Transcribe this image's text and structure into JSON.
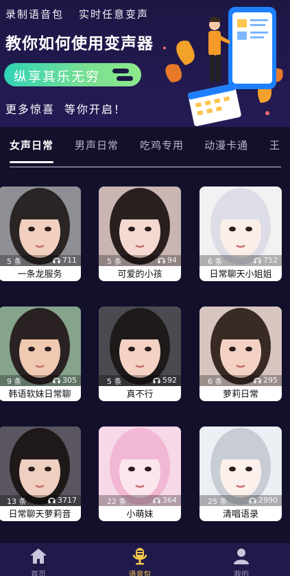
{
  "banner": {
    "top_left": "录制语音包",
    "top_right": "实时任意变声",
    "title": "教你如何使用变声器",
    "pill": "纵享其乐无穷",
    "bottom_left": "更多惊喜",
    "bottom_right": "等你开启！"
  },
  "tabs": [
    {
      "label": "女声日常",
      "active": true
    },
    {
      "label": "男声日常",
      "active": false
    },
    {
      "label": "吃鸡专用",
      "active": false
    },
    {
      "label": "动漫卡通",
      "active": false
    },
    {
      "label": "王",
      "active": false
    }
  ],
  "cards": [
    {
      "count": "5 条",
      "plays": "711",
      "name": "一条龙服务"
    },
    {
      "count": "5 条",
      "plays": "94",
      "name": "可爱的小孩"
    },
    {
      "count": "6 条",
      "plays": "752",
      "name": "日常聊天小姐姐"
    },
    {
      "count": "9 条",
      "plays": "305",
      "name": "韩语软妹日常聊"
    },
    {
      "count": "5 条",
      "plays": "592",
      "name": "真不行"
    },
    {
      "count": "6 条",
      "plays": "295",
      "name": "萝莉日常"
    },
    {
      "count": "13 条",
      "plays": "3717",
      "name": "日常聊天萝莉音"
    },
    {
      "count": "22 条",
      "plays": "364",
      "name": "小萌妹"
    },
    {
      "count": "25 条",
      "plays": "2990",
      "name": "清唱语录"
    }
  ],
  "nav": [
    {
      "label": "首页",
      "icon": "home-icon",
      "active": false
    },
    {
      "label": "语音包",
      "icon": "microphone-icon",
      "active": true
    },
    {
      "label": "我的",
      "icon": "user-icon",
      "active": false
    }
  ],
  "colors": {
    "background": "#13102b",
    "banner": "#1d1745",
    "pill_start": "#2fd3b6",
    "pill_end": "#8ee88a",
    "nav_bg": "#1f1a49",
    "nav_active": "#f5c84a"
  }
}
